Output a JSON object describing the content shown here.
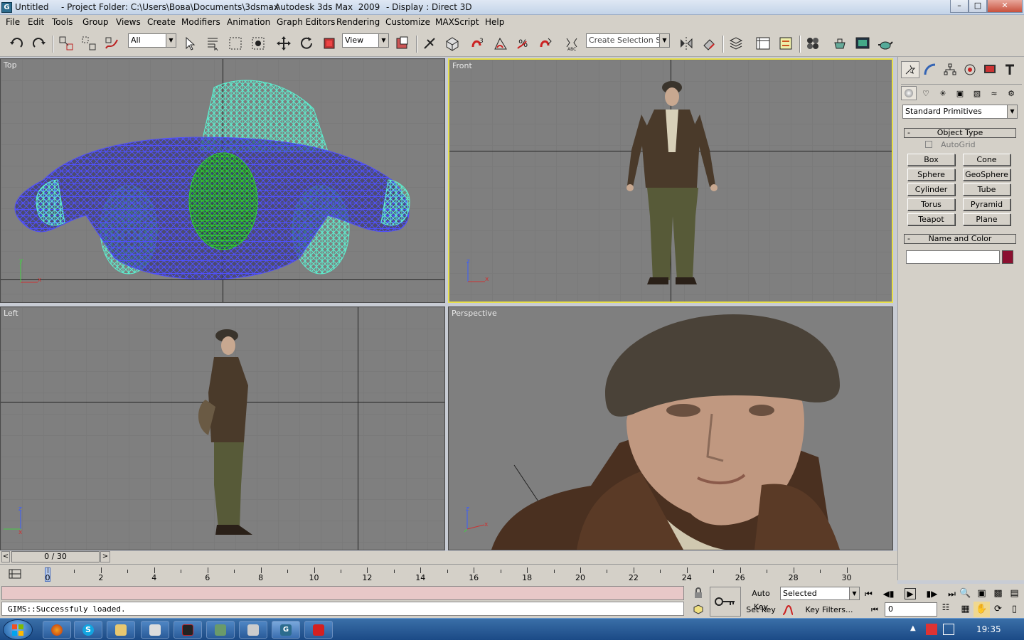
{
  "window": {
    "doc_title": "Untitled",
    "project": "- Project Folder: C:\\Users\\Вова\\Documents\\3dsmax",
    "app": "- Autodesk 3ds Max  2009",
    "display": "- Display : Direct 3D",
    "app_icon": "G"
  },
  "menu": [
    "File",
    "Edit",
    "Tools",
    "Group",
    "Views",
    "Create",
    "Modifiers",
    "Animation",
    "Graph Editors",
    "Rendering",
    "Customize",
    "MAXScript",
    "Help"
  ],
  "toolbar": {
    "filter_value": "All",
    "refcoord_value": "View",
    "selection_set_placeholder": "Create Selection Set"
  },
  "viewports": {
    "top": "Top",
    "front": "Front",
    "left": "Left",
    "perspective": "Perspective",
    "axis_x": "x",
    "axis_y": "y",
    "axis_z": "z"
  },
  "command_panel": {
    "category_dropdown": "Standard Primitives",
    "object_type_title": "Object Type",
    "autogrid_label": "AutoGrid",
    "primitives": [
      "Box",
      "Cone",
      "Sphere",
      "GeoSphere",
      "Cylinder",
      "Tube",
      "Torus",
      "Pyramid",
      "Teapot",
      "Plane"
    ],
    "name_color_title": "Name and Color",
    "color_swatch": "#8b1030",
    "rollout_minus": "-"
  },
  "timeline": {
    "slider_text": "0 / 30",
    "ticks": [
      "0",
      "2",
      "4",
      "6",
      "8",
      "10",
      "12",
      "14",
      "16",
      "18",
      "20",
      "22",
      "24",
      "26",
      "28",
      "30"
    ],
    "prev_arrow": "<",
    "next_arrow": ">"
  },
  "status": {
    "script_output": "GIMS::Successfuly loaded.",
    "auto_key": "Auto Key",
    "set_key": "Set Key",
    "selected_dropdown": "Selected",
    "key_filters": "Key Filters...",
    "frame_value": "0"
  },
  "taskbar": {
    "clock": "19:35"
  }
}
